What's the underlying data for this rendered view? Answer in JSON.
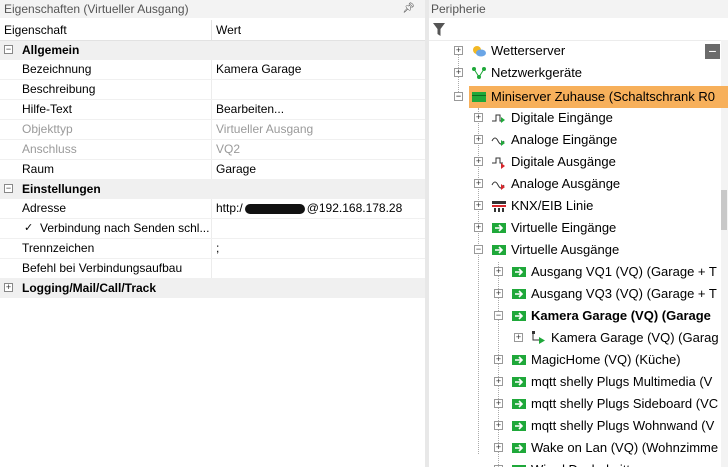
{
  "left_panel": {
    "title": "Eigenschaften (Virtueller Ausgang)",
    "pin": "ᴾ"
  },
  "right_panel": {
    "title": "Peripherie"
  },
  "grid": {
    "col1": "Eigenschaft",
    "col2": "Wert",
    "cat_allgemein": "Allgemein",
    "bezeichnung_label": "Bezeichnung",
    "bezeichnung_value": "Kamera Garage",
    "beschreibung_label": "Beschreibung",
    "hilfe_label": "Hilfe-Text",
    "hilfe_value": "Bearbeiten...",
    "objekttyp_label": "Objekttyp",
    "objekttyp_value": "Virtueller Ausgang",
    "anschluss_label": "Anschluss",
    "anschluss_value": "VQ2",
    "raum_label": "Raum",
    "raum_value": "Garage",
    "cat_einstellungen": "Einstellungen",
    "adresse_label": "Adresse",
    "adresse_prefix": "http:/",
    "adresse_suffix": "@192.168.178.28",
    "verbindung_label": "Verbindung nach Senden schl...",
    "trennzeichen_label": "Trennzeichen",
    "trennzeichen_value": ";",
    "befehl_label": "Befehl bei Verbindungsaufbau",
    "cat_logging": "Logging/Mail/Call/Track"
  },
  "tree": {
    "n0": "Wetterserver",
    "n1": "Netzwerkgeräte",
    "n2": "Miniserver Zuhause (Schaltschrank R0",
    "n3": "Digitale Eingänge",
    "n4": "Analoge Eingänge",
    "n5": "Digitale Ausgänge",
    "n6": "Analoge Ausgänge",
    "n7": "KNX/EIB Linie",
    "n8": "Virtuelle Eingänge",
    "n9": "Virtuelle Ausgänge",
    "n10": "Ausgang VQ1 (VQ) (Garage + T",
    "n11": "Ausgang VQ3 (VQ) (Garage + T",
    "n12": "Kamera Garage (VQ) (Garage",
    "n13": "Kamera Garage (VQ) (Garag",
    "n14": "MagicHome (VQ) (Küche)",
    "n15": "mqtt shelly Plugs Multimedia (V",
    "n16": "mqtt shelly Plugs Sideboard (VC",
    "n17": "mqtt shelly Plugs Wohnwand (V",
    "n18": "Wake on Lan (VQ) (Wohnzimme",
    "n19": "Wired Dazhubsitt..."
  },
  "colors": {
    "highlight": "#f7b05b",
    "green": "#1fa83a"
  }
}
